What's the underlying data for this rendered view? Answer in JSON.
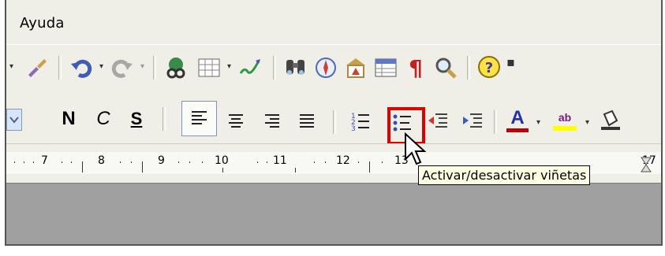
{
  "menubar": {
    "help_label": "Ayuda"
  },
  "format_toolbar": {
    "bold": "N",
    "italic": "C",
    "underline": "S",
    "font_color_letter": "A",
    "highlight_letters": "ab"
  },
  "ruler": {
    "ticks": [
      "7",
      "8",
      "9",
      "10",
      "11",
      "12",
      "13",
      "17"
    ]
  },
  "tooltip": {
    "text": "Activar/desactivar viñetas"
  },
  "colors": {
    "highlight_border": "#e00000",
    "tooltip_bg": "#ffffe1",
    "workspace_gray": "#a0a0a0"
  }
}
